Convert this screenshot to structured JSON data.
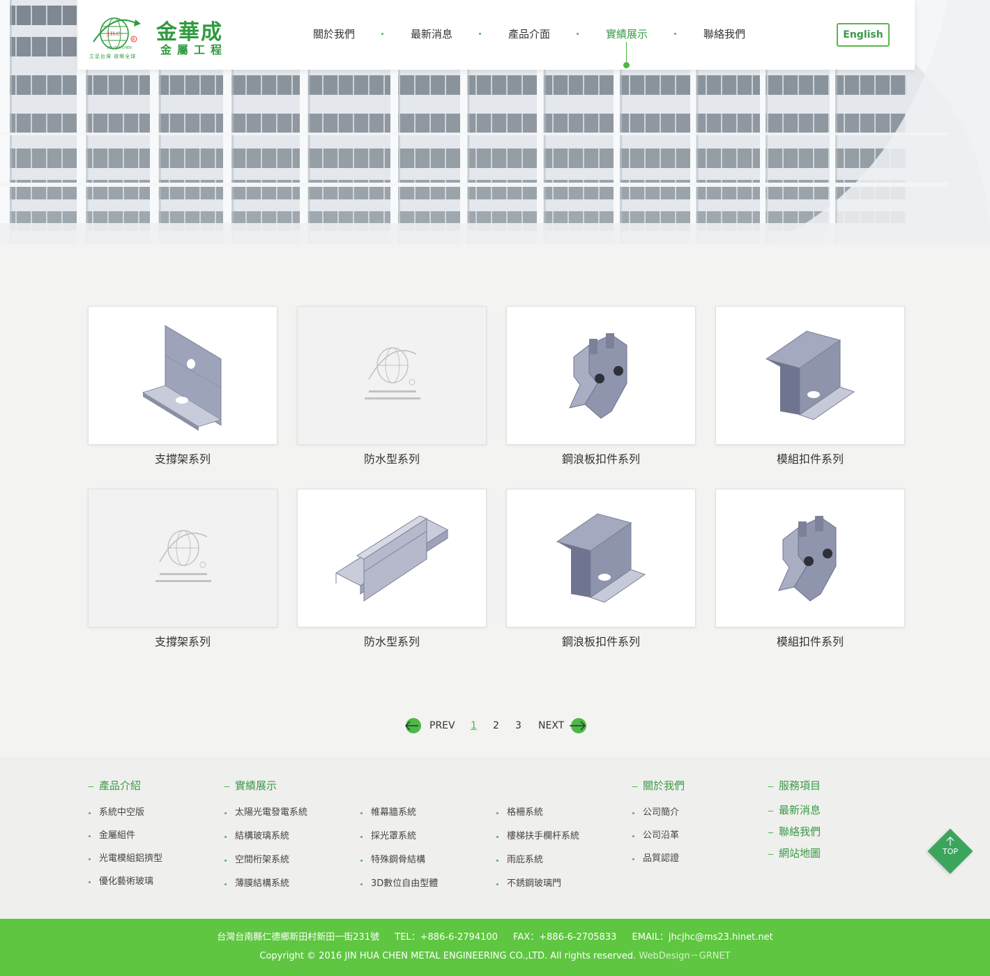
{
  "header": {
    "logo": {
      "name": "金華成",
      "subtitle": "金屬工程",
      "slogan": "立足台灣 放眼全球",
      "english": "JIN HUA CHEN",
      "mark": "J.H.C"
    },
    "nav": [
      {
        "label": "關於我們",
        "active": false
      },
      {
        "label": "最新消息",
        "active": false
      },
      {
        "label": "產品介面",
        "active": false
      },
      {
        "label": "實績展示",
        "active": true
      },
      {
        "label": "聯絡我們",
        "active": false
      }
    ],
    "language_button": "English"
  },
  "products": [
    {
      "title": "支撐架系列",
      "image": "l-bracket"
    },
    {
      "title": "防水型系列",
      "image": "logo-placeholder"
    },
    {
      "title": "鋼浪板扣件系列",
      "image": "clamp-bolted"
    },
    {
      "title": "模組扣件系列",
      "image": "z-bracket"
    },
    {
      "title": "支撐架系列",
      "image": "logo-placeholder"
    },
    {
      "title": "防水型系列",
      "image": "rail-profile"
    },
    {
      "title": "鋼浪板扣件系列",
      "image": "z-bracket"
    },
    {
      "title": "模組扣件系列",
      "image": "clamp-bolted"
    }
  ],
  "pagination": {
    "prev": "PREV",
    "next": "NEXT",
    "pages": [
      "1",
      "2",
      "3"
    ],
    "current": "1"
  },
  "footer": {
    "products_heading": "產品介紹",
    "products_links": [
      "系統中空版",
      "金屬組件",
      "光電模組鋁擠型",
      "優化藝術玻璃"
    ],
    "works_heading": "實績展示",
    "works_col1": [
      "太陽光電發電系統",
      "結構玻璃系統",
      "空間桁架系統",
      "薄膜結構系統"
    ],
    "works_col2": [
      "帷幕牆系統",
      "採光罩系統",
      "特殊鋼骨結構",
      "3D數位自由型體"
    ],
    "works_col3": [
      "格柵系統",
      "樓梯扶手欄杆系統",
      "雨庇系統",
      "不銹鋼玻璃門"
    ],
    "about_heading": "關於我們",
    "about_links": [
      "公司簡介",
      "公司沿革",
      "品質認證"
    ],
    "service_heading": "服務項目",
    "side_links": [
      "最新消息",
      "聯絡我們",
      "網站地圖"
    ],
    "top_label": "TOP"
  },
  "bottom_bar": {
    "address": "台灣台南縣仁德鄉新田村新田一街231號",
    "tel": "TEL：+886-6-2794100",
    "fax": "FAX：+886-6-2705833",
    "email": "EMAIL：jhcjhc@ms23.hinet.net",
    "copyright": "Copyright © 2016 JIN HUA CHEN METAL ENGINEERING CO.,LTD. All rights reserved.",
    "design_credit": "WebDesign－GRNET"
  },
  "colors": {
    "brand_green": "#4cb848",
    "logo_green": "#2f9a3e",
    "bottom_bar": "#5ec640",
    "top_button": "#3ba55c"
  }
}
